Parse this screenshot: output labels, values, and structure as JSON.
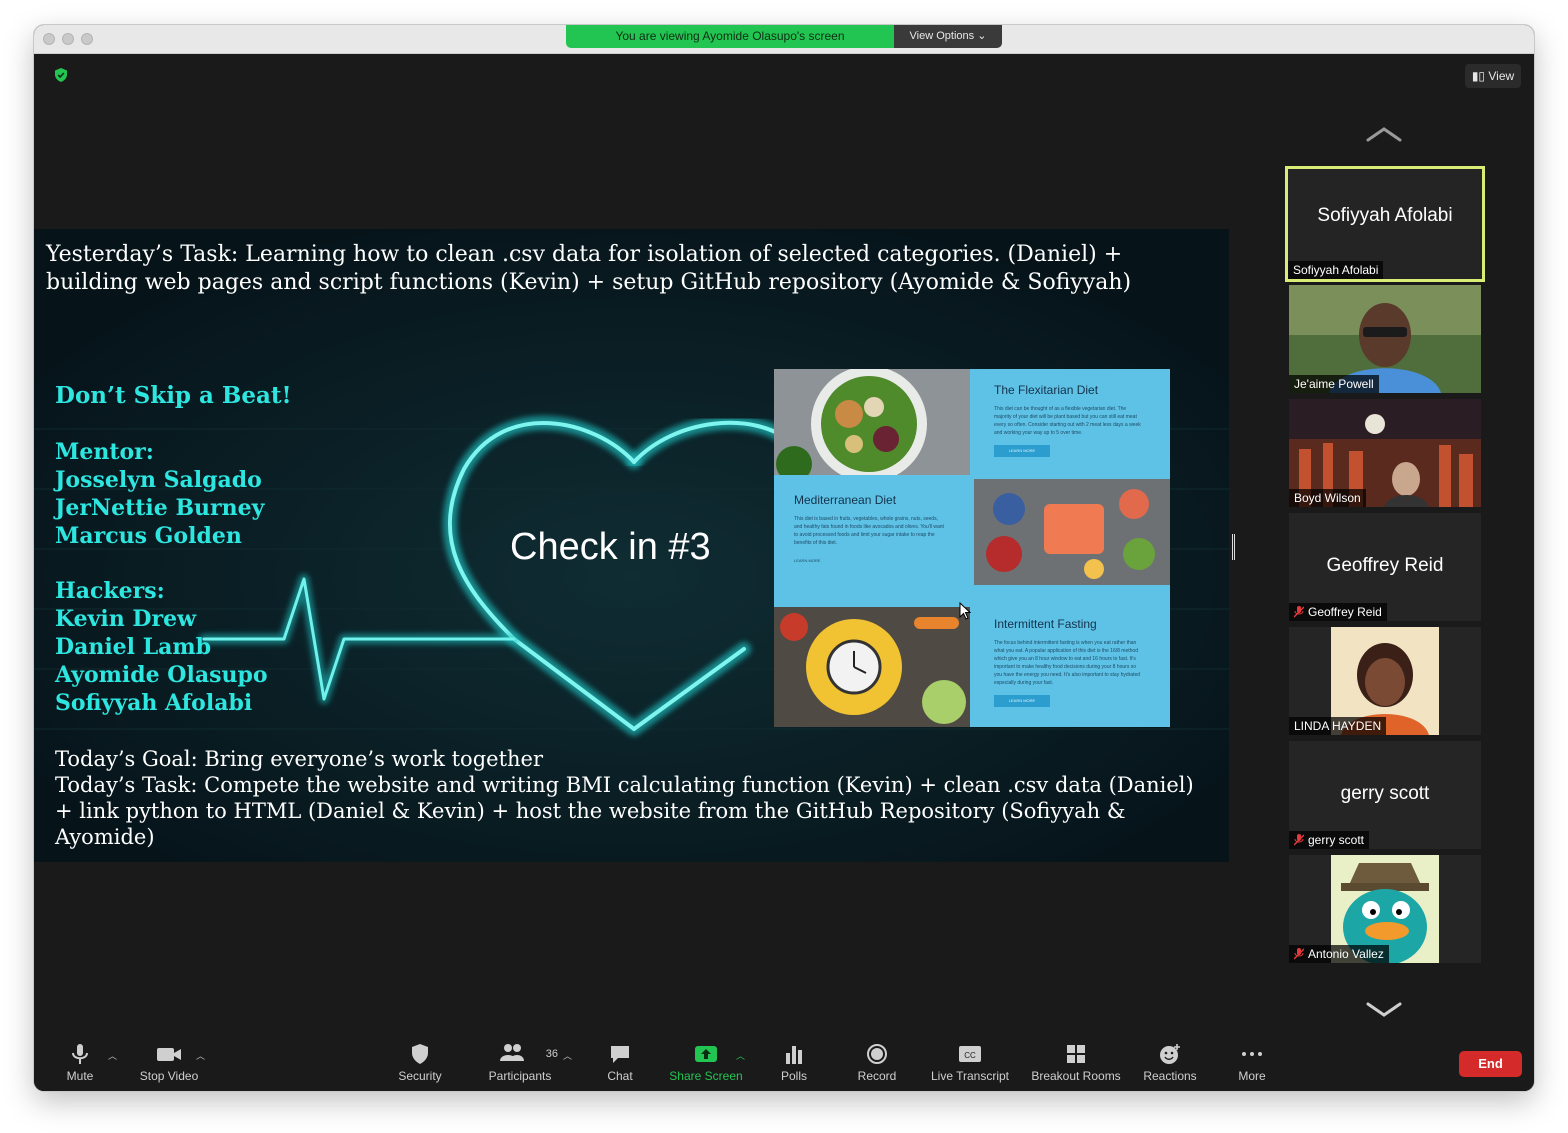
{
  "share_banner": {
    "message": "You are viewing Ayomide Olasupo's screen",
    "view_options": "View Options"
  },
  "view_button": "View",
  "slide": {
    "top_text": "Yesterday’s Task: Learning how to clean .csv data for isolation of selected categories. (Daniel) + building web pages and script functions (Kevin) + setup GitHub repository (Ayomide & Sofiyyah)",
    "heading": "Don’t Skip a Beat!",
    "mentor_label": "Mentor:",
    "mentors": [
      "Josselyn Salgado",
      "JerNettie Burney",
      "Marcus Golden"
    ],
    "hackers_label": "Hackers:",
    "hackers": [
      "Kevin Drew",
      "Daniel Lamb",
      "Ayomide Olasupo",
      "Sofiyyah Afolabi"
    ],
    "center_text": "Check in #3",
    "bottom_goal": "Today’s Goal: Bring everyone’s work together",
    "bottom_task": "Today’s Task: Compete the website and writing BMI calculating  function (Kevin) + clean .csv data (Daniel) + link python to HTML (Daniel & Kevin) + host the website from the GitHub Repository (Sofiyyah & Ayomide)",
    "site_cards": [
      {
        "title": "The Flexitarian Diet",
        "text": "This diet can be thought of as a flexible vegetarian diet. The majority of your diet will be plant based but you can still eat meat every so often. Consider starting out with 2 meat less days a week and working your way up to 5 over time.",
        "button": "LEARN MORE"
      },
      {
        "title": "Mediterranean Diet",
        "text": "This diet is based in fruits, vegetables, whole grains, nuts, seeds, and healthy fats found in foods like avocados and olives. You'll want to avoid processed foods and limit your sugar intake to reap the benefits of this diet.",
        "button": "LEARN MORE"
      },
      {
        "title": "Intermittent Fasting",
        "text": "The focus behind intermittent fasting is when you eat rather than what you eat. A popular application of this diet is the 16/8 method which give you an 8 hour window to eat and 16 hours to fast. It's important to make healthy food decisions during your 8 hours so you have the energy you need. It's also important to stay hydrated especially during your fast.",
        "button": "LEARN MORE"
      }
    ]
  },
  "participants": [
    {
      "display_name": "Sofiyyah Afolabi",
      "tag": "Sofiyyah Afolabi",
      "video": false,
      "muted": false,
      "active": true
    },
    {
      "display_name": "",
      "tag": "Je'aime Powell",
      "video": true,
      "muted": false,
      "active": false
    },
    {
      "display_name": "",
      "tag": "Boyd Wilson",
      "video": true,
      "muted": false,
      "active": false
    },
    {
      "display_name": "Geoffrey Reid",
      "tag": "Geoffrey Reid",
      "video": false,
      "muted": true,
      "active": false
    },
    {
      "display_name": "",
      "tag": "LINDA HAYDEN",
      "video": true,
      "muted": false,
      "active": false
    },
    {
      "display_name": "gerry scott",
      "tag": "gerry scott",
      "video": false,
      "muted": true,
      "active": false
    },
    {
      "display_name": "",
      "tag": "Antonio Vallez",
      "video": true,
      "muted": true,
      "active": false
    }
  ],
  "toolbar": {
    "mute": "Mute",
    "stop_video": "Stop Video",
    "security": "Security",
    "participants": "Participants",
    "participants_count": "36",
    "chat": "Chat",
    "share_screen": "Share Screen",
    "polls": "Polls",
    "record": "Record",
    "live_transcript": "Live Transcript",
    "breakout_rooms": "Breakout Rooms",
    "reactions": "Reactions",
    "more": "More",
    "end": "End"
  },
  "colors": {
    "share_green": "#23c552",
    "active_speaker_border": "#d9ec76",
    "slide_accent": "#2ee6e0",
    "end_red": "#d42a2a"
  }
}
